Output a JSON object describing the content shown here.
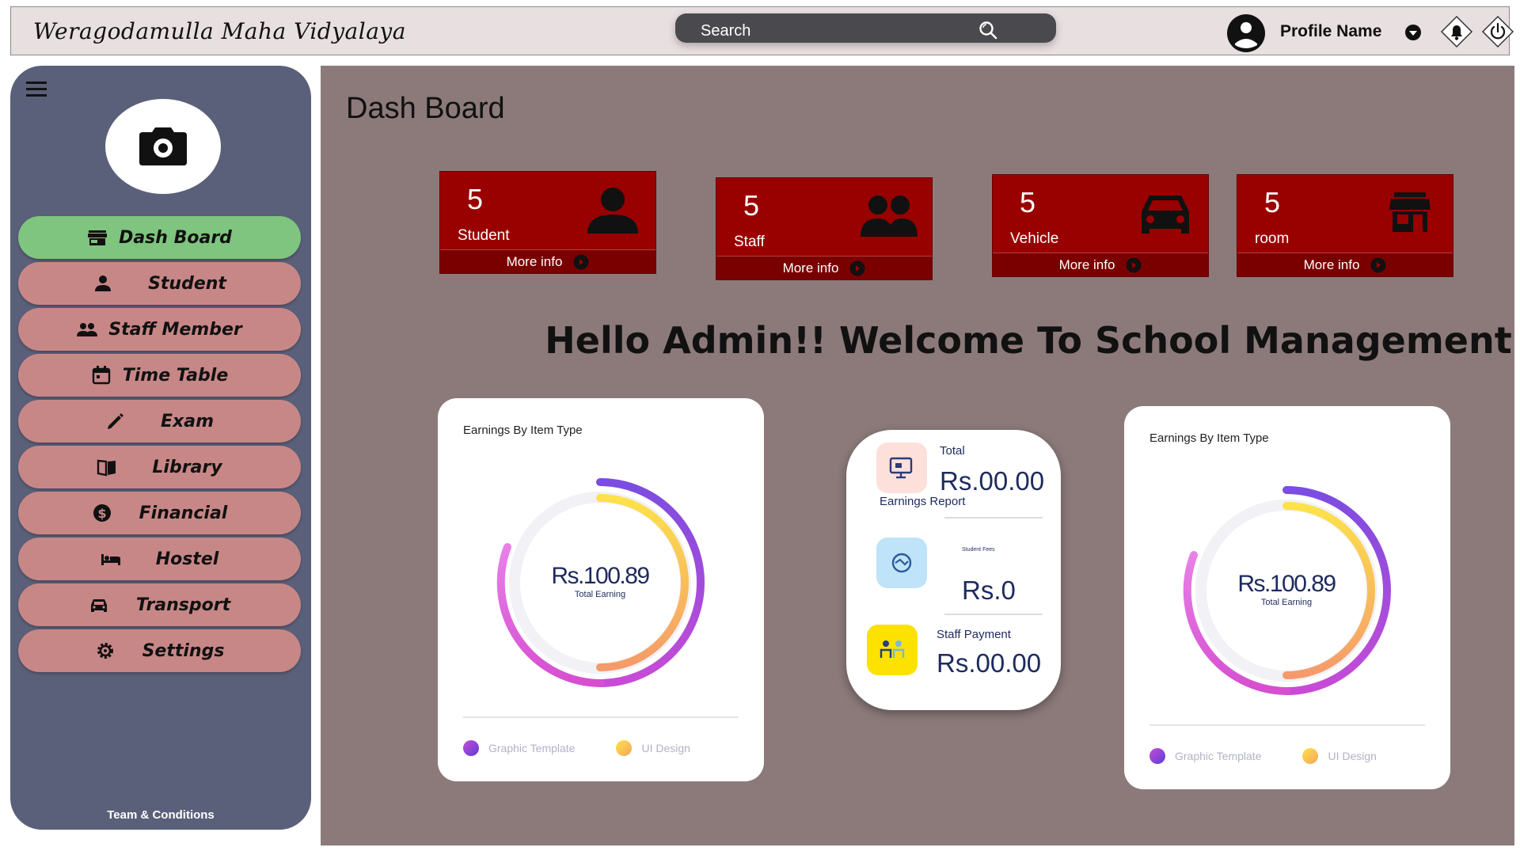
{
  "header": {
    "school_name": "Weragodamulla Maha Vidyalaya",
    "search_placeholder": "Search",
    "profile_name": "Profile Name"
  },
  "sidebar": {
    "items": [
      {
        "label": "Dash Board",
        "icon": "store-icon",
        "active": true
      },
      {
        "label": "Student",
        "icon": "person-icon",
        "active": false
      },
      {
        "label": "Staff Member",
        "icon": "group-icon",
        "active": false
      },
      {
        "label": "Time Table",
        "icon": "calendar-icon",
        "active": false
      },
      {
        "label": "Exam",
        "icon": "pencil-icon",
        "active": false
      },
      {
        "label": "Library",
        "icon": "book-icon",
        "active": false
      },
      {
        "label": "Financial",
        "icon": "dollar-icon",
        "active": false
      },
      {
        "label": "Hostel",
        "icon": "bed-icon",
        "active": false
      },
      {
        "label": "Transport",
        "icon": "car-icon",
        "active": false
      },
      {
        "label": "Settings",
        "icon": "gear-icon",
        "active": false
      }
    ],
    "footer": "Team & Conditions"
  },
  "main": {
    "title": "Dash Board",
    "stats": [
      {
        "count": "5",
        "label": "Student",
        "more": "More info",
        "icon": "person-icon"
      },
      {
        "count": "5",
        "label": "Staff",
        "more": "More info",
        "icon": "group-icon"
      },
      {
        "count": "5",
        "label": "Vehicle",
        "more": "More info",
        "icon": "car-icon"
      },
      {
        "count": "5",
        "label": "room",
        "more": "More info",
        "icon": "store-icon"
      }
    ],
    "welcome": "Hello Admin!! Welcome To School Management",
    "panels": [
      {
        "title": "Earnings By Item Type",
        "value": "Rs.100.89",
        "value_label": "Total Earning",
        "legend": [
          "Graphic Template",
          "UI Design"
        ]
      },
      {
        "title": "Earnings By Item Type",
        "value": "Rs.100.89",
        "value_label": "Total Earning",
        "legend": [
          "Graphic Template",
          "UI Design"
        ]
      }
    ],
    "earnings": {
      "total_label": "Total",
      "total_value": "Rs.00.00",
      "report_label": "Earnings Report",
      "fees_label": "Student Fees",
      "fees_value": "Rs.0",
      "staff_label": "Staff Payment",
      "staff_value": "Rs.00.00"
    }
  },
  "colors": {
    "active_nav": "#7fc47f",
    "nav": "#c88787",
    "sidebar": "#5a6079",
    "main_bg": "#8c7a7a",
    "stat_card": "#990000"
  }
}
